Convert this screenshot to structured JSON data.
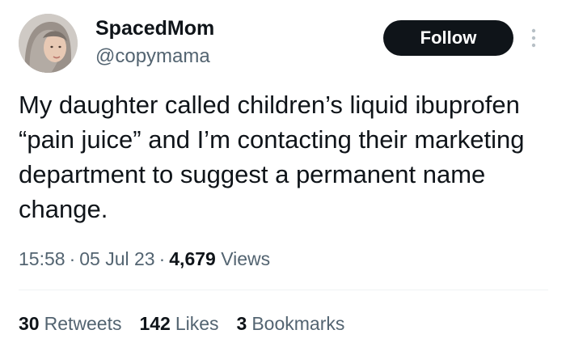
{
  "user": {
    "display_name": "SpacedMom",
    "handle": "@copymama"
  },
  "follow_label": "Follow",
  "tweet": {
    "text": "My daughter called children’s liquid ibuprofen “pain juice” and I’m contacting their marketing department to suggest a permanent name change."
  },
  "meta": {
    "time": "15:58",
    "date": "05 Jul 23",
    "views_count": "4,679",
    "views_label": "Views",
    "separator": "·"
  },
  "stats": {
    "retweets_count": "30",
    "retweets_label": "Retweets",
    "likes_count": "142",
    "likes_label": "Likes",
    "bookmarks_count": "3",
    "bookmarks_label": "Bookmarks"
  },
  "icons": {
    "more": "more-vertical-icon",
    "avatar": "avatar-photo"
  },
  "colors": {
    "primary_text": "#0f1419",
    "secondary_text": "#536471",
    "follow_bg": "#0f1419",
    "divider": "#eff3f4"
  }
}
